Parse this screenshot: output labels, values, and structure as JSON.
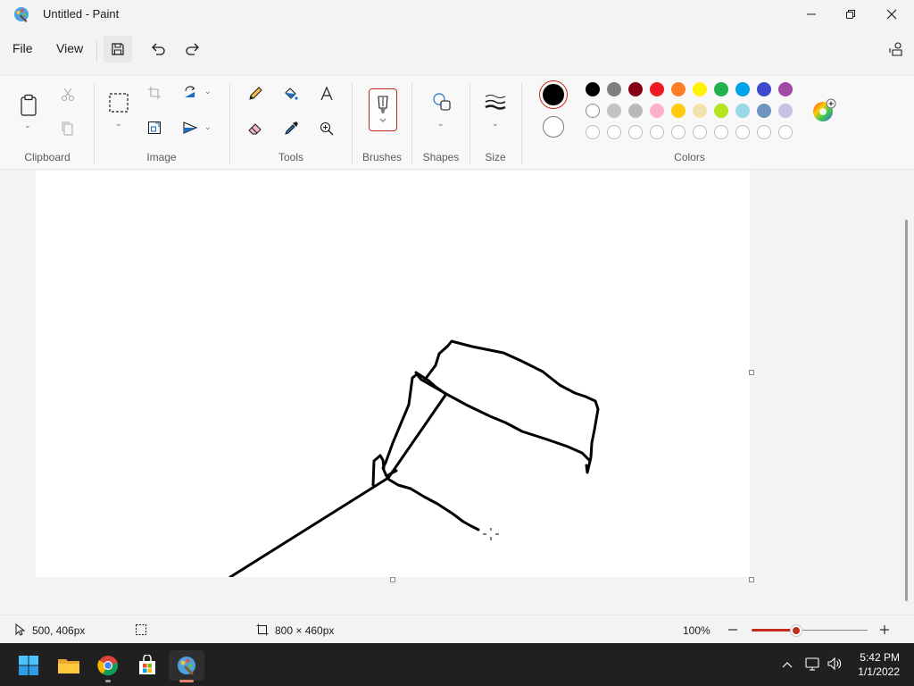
{
  "window": {
    "title": "Untitled - Paint"
  },
  "menu": {
    "file": "File",
    "view": "View"
  },
  "ribbon": {
    "groups": {
      "clipboard": "Clipboard",
      "image": "Image",
      "tools": "Tools",
      "brushes": "Brushes",
      "shapes": "Shapes",
      "size": "Size",
      "colors": "Colors"
    },
    "primary_color": "#000000",
    "secondary_color": "#ffffff",
    "palette_row1": [
      "#000000",
      "#7f7f7f",
      "#880015",
      "#ed1c24",
      "#ff7f27",
      "#fff200",
      "#22b14c",
      "#00a2e8",
      "#3f48cc",
      "#a349a4"
    ],
    "palette_row2": [
      "#ffffff",
      "#c3c3c3",
      "#b9b9b9",
      "#ffaec9",
      "#ffc90e",
      "#efe4b0",
      "#b5e61d",
      "#99d9ea",
      "#7092be",
      "#c8bfe7"
    ],
    "palette_row3_count": 10
  },
  "status": {
    "cursor_position": "500, 406px",
    "canvas_size": "800 × 460px",
    "zoom": "100%",
    "zoom_fraction": 0.38
  },
  "taskbar": {
    "time": "5:42 PM",
    "date": "1/1/2022",
    "apps": [
      "start-menu",
      "file-explorer",
      "chrome",
      "microsoft-store",
      "paint"
    ]
  },
  "colors": {
    "accent": "#c42b1c",
    "stroke": "#000000"
  }
}
